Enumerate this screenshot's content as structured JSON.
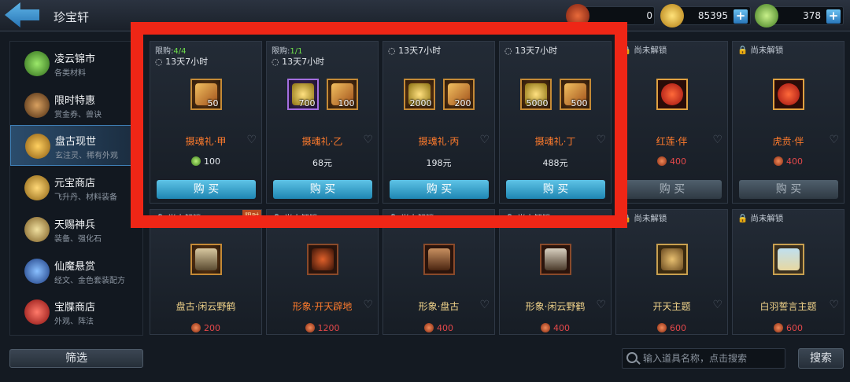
{
  "header": {
    "title": "珍宝轩"
  },
  "currencies": [
    {
      "value": "0",
      "icon": "red-fan-icon",
      "color": "#c94a2a"
    },
    {
      "value": "85395",
      "icon": "gold-ingot-icon",
      "color": "#d9a830"
    },
    {
      "value": "378",
      "icon": "jade-coin-icon",
      "color": "#7fc04a"
    }
  ],
  "sidebar": {
    "items": [
      {
        "name": "凌云锦市",
        "sub": "各类材料",
        "icon": "jade-coin-icon",
        "color": "#4fa63a"
      },
      {
        "name": "限时特惠",
        "sub": "赏金券、兽诀",
        "icon": "hourglass-icon",
        "color": "#8a5a2a"
      },
      {
        "name": "盘古现世",
        "sub": "玄注灵、稀有外观",
        "icon": "bell-icon",
        "color": "#e0a020"
      },
      {
        "name": "元宝商店",
        "sub": "飞升丹、材料装备",
        "icon": "treasure-pot-icon",
        "color": "#d0a030"
      },
      {
        "name": "天赐神兵",
        "sub": "装备、强化石",
        "icon": "weapon-icon",
        "color": "#c09040"
      },
      {
        "name": "仙魔悬赏",
        "sub": "经文、金色套装配方",
        "icon": "hexagon-gem-icon",
        "color": "#3a6fc0"
      },
      {
        "name": "宝牒商店",
        "sub": "外观、阵法",
        "icon": "red-packet-icon",
        "color": "#d03030"
      }
    ]
  },
  "cards_row1": [
    {
      "limit_label": "限购:",
      "limit_value": "4/4",
      "timer": "13天7小时",
      "name": "摄魂礼·甲",
      "price": "100",
      "buy": "购 买",
      "slots": [
        "50"
      ]
    },
    {
      "limit_label": "限购:",
      "limit_value": "1/1",
      "timer": "13天7小时",
      "name": "摄魂礼·乙",
      "price": "68元",
      "buy": "购 买",
      "slots": [
        "700",
        "100"
      ]
    },
    {
      "timer": "13天7小时",
      "name": "摄魂礼·丙",
      "price": "198元",
      "buy": "购 买",
      "slots": [
        "2000",
        "200"
      ]
    },
    {
      "timer": "13天7小时",
      "name": "摄魂礼·丁",
      "price": "488元",
      "buy": "购 买",
      "slots": [
        "5000",
        "500"
      ]
    },
    {
      "lock": "尚未解锁",
      "name": "红莲·伴",
      "price": "400",
      "buy": "购 买"
    },
    {
      "lock": "尚未解锁",
      "name": "虎贲·伴",
      "price": "400",
      "buy": "购 买"
    }
  ],
  "cards_row2": [
    {
      "lock": "尚未解锁",
      "badge": "限时",
      "name": "盘古·闲云野鹤",
      "price": "200"
    },
    {
      "lock": "尚未解锁",
      "name": "形象·开天辟地",
      "price": "1200"
    },
    {
      "lock": "尚未解锁",
      "name": "形象·盘古",
      "price": "400"
    },
    {
      "lock": "尚未解锁",
      "name": "形象·闲云野鹤",
      "price": "400"
    },
    {
      "lock": "尚未解锁",
      "name": "开天主题",
      "price": "600"
    },
    {
      "lock": "尚未解锁",
      "name": "白羽誓言主题",
      "price": "600"
    }
  ],
  "footer": {
    "filter": "筛选",
    "search_placeholder": "输入道具名称，点击搜索",
    "search_button": "搜索"
  }
}
